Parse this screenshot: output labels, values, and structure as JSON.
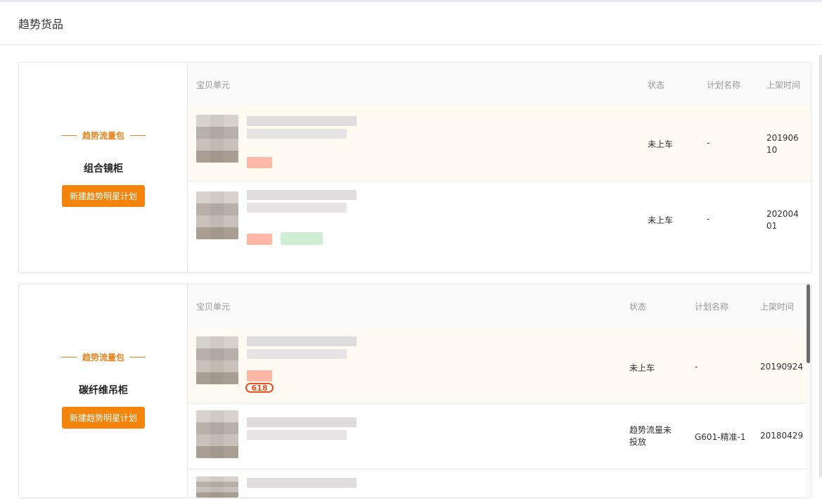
{
  "page": {
    "title": "趋势货品"
  },
  "columns": {
    "item": "宝贝单元",
    "status": "状态",
    "plan": "计划名称",
    "date": "上架时间"
  },
  "cards": [
    {
      "package_label": "趋势流量包",
      "category": "组合镜柜",
      "button_label": "新建趋势明星计划",
      "rows": [
        {
          "status": "未上车",
          "plan": "-",
          "date": "20190610"
        },
        {
          "status": "未上车",
          "plan": "-",
          "date": "20200401"
        }
      ]
    },
    {
      "package_label": "趋势流量包",
      "category": "碳纤维吊柜",
      "button_label": "新建趋势明星计划",
      "rows": [
        {
          "status": "未上车",
          "plan": "-",
          "date": "20190924",
          "tag": "618"
        },
        {
          "status": "趋势流量未投放",
          "plan": "G601-精准-1",
          "date": "20180429"
        }
      ]
    }
  ],
  "colors": {
    "accent": "#f5840c",
    "package_label": "#e8831f",
    "row_highlight": "#fffaf2"
  }
}
